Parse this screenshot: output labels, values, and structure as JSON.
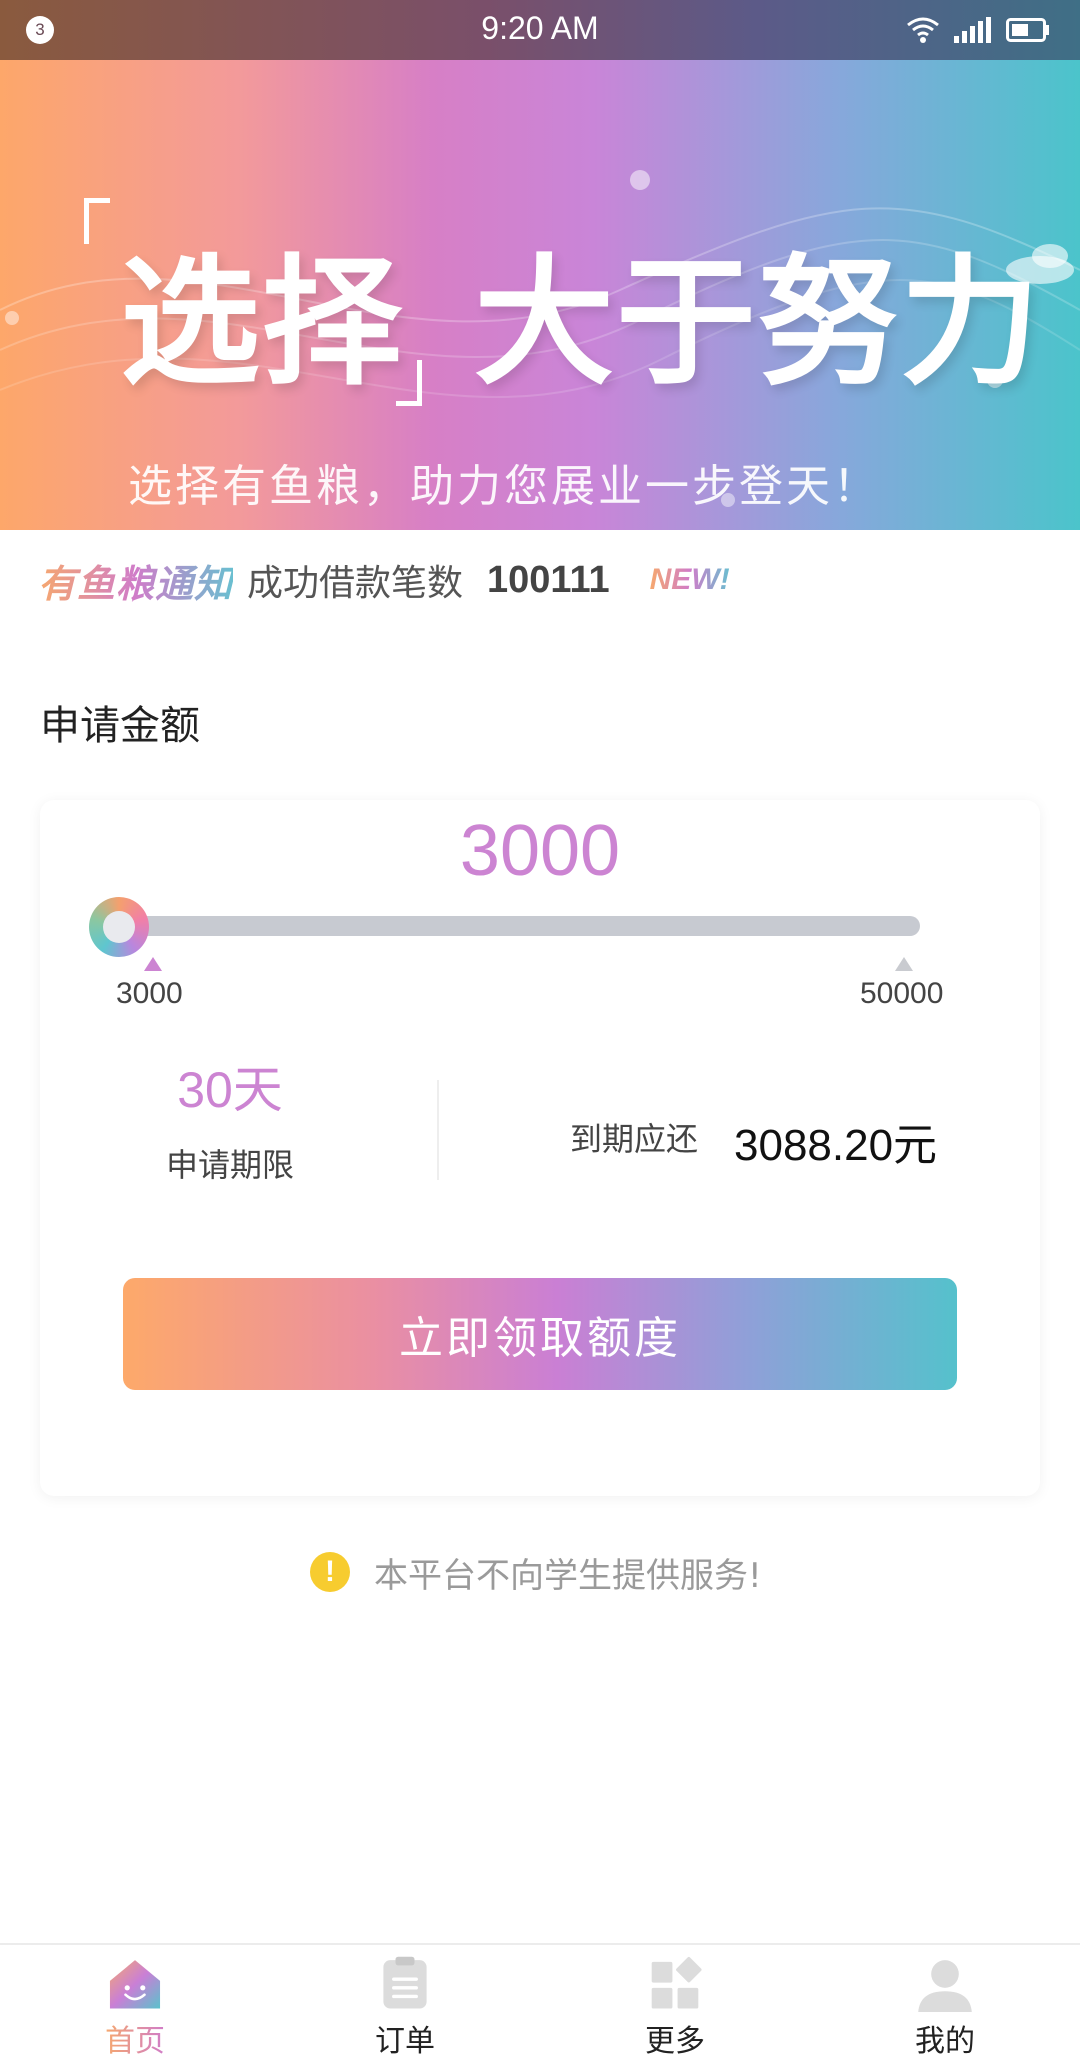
{
  "status_bar": {
    "notification_count": "3",
    "time": "9:20 AM",
    "icons": [
      "wifi-icon",
      "signal-icon",
      "battery-icon"
    ]
  },
  "banner": {
    "title_part1": "选择",
    "title_part2": "大于努力",
    "subtitle": "选择有鱼粮，助力您展业一步登天！",
    "slide_count": 3,
    "active_slide": 3
  },
  "notice": {
    "brand": "有鱼粮通知",
    "text": "成功借款笔数",
    "count": "100111",
    "badge": "NEW!"
  },
  "loan": {
    "section_title": "申请金额",
    "amount": "3000",
    "slider_min_label": "3000",
    "slider_max_label": "50000",
    "slider_value": 3000,
    "term_value": "30天",
    "term_label": "申请期限",
    "due_label": "到期应还",
    "due_value": "3088.20元",
    "cta_label": "立即领取额度"
  },
  "warning": {
    "icon": "!",
    "text": "本平台不向学生提供服务!"
  },
  "bottom_nav": {
    "items": [
      {
        "label": "首页",
        "icon": "home-icon",
        "active": true
      },
      {
        "label": "订单",
        "icon": "orders-icon",
        "active": false
      },
      {
        "label": "更多",
        "icon": "more-icon",
        "active": false
      },
      {
        "label": "我的",
        "icon": "profile-icon",
        "active": false
      }
    ]
  },
  "colors": {
    "accent_purple": "#cc84d2",
    "gradient_start": "#fda96a",
    "gradient_end": "#55c1cc",
    "warning_yellow": "#f7cc2f"
  }
}
